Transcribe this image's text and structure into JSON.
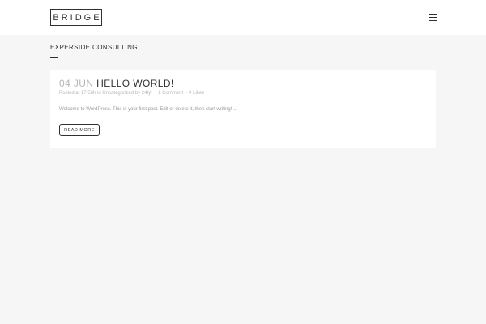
{
  "header": {
    "logo_text": "BRIDGE",
    "menu_icon": "hamburger-icon"
  },
  "page": {
    "title": "EXPERSIDE CONSULTING"
  },
  "post": {
    "date": "04 JUN",
    "title": "HELLO WORLD!",
    "meta": {
      "posted_at": "Posted at 17:56h",
      "in": "in",
      "category": "Uncategorized",
      "by": "by",
      "author": "24tyr",
      "sep": "·",
      "comments": "1 Comment",
      "likes": "0 Likes"
    },
    "excerpt": "Welcome to WordPress. This is your first post. Edit or delete it, then start writing! ...",
    "read_more_label": "READ MORE"
  }
}
